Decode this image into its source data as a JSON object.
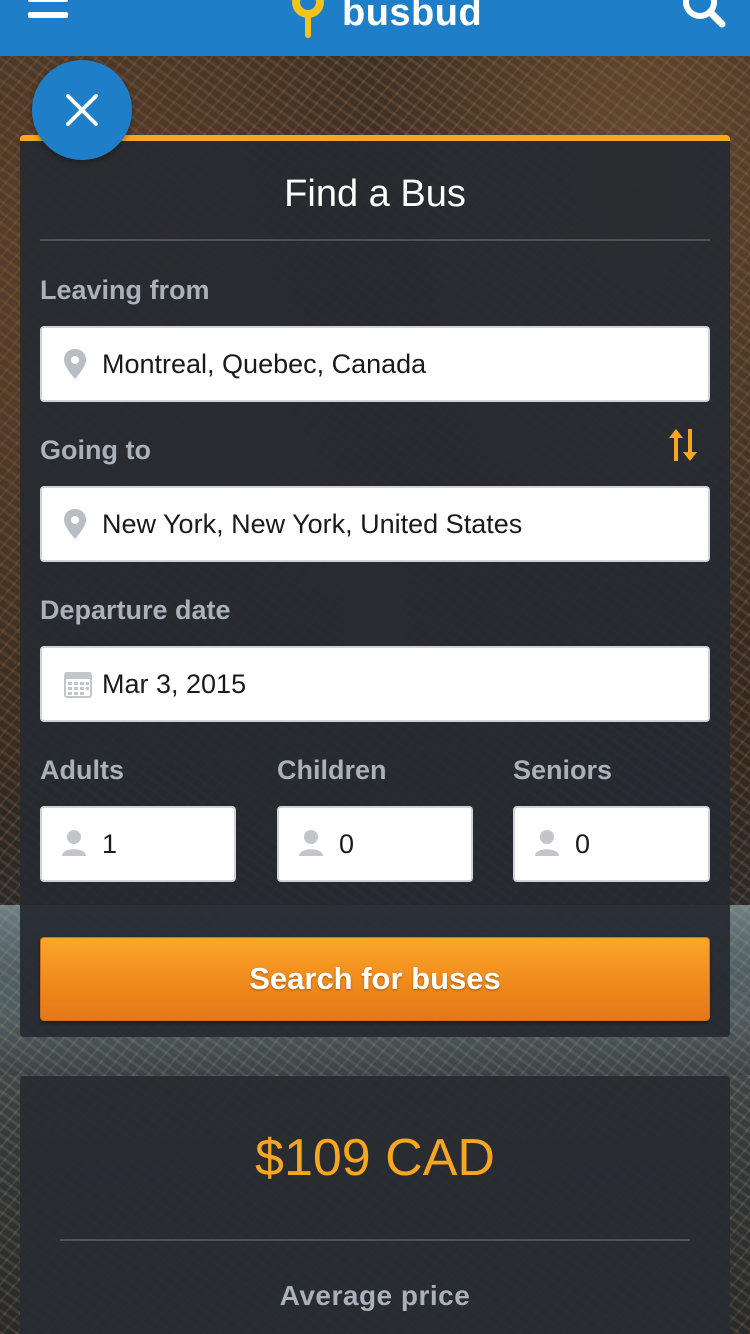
{
  "header": {
    "brand": "busbud",
    "brand_color": "#1e7fc8",
    "menu_icon": "hamburger-menu-icon",
    "search_icon": "search-icon"
  },
  "close_icon": "close-icon",
  "form": {
    "title": "Find a Bus",
    "accent_color": "#f7a623",
    "leaving_from": {
      "label": "Leaving from",
      "value": "Montreal, Quebec, Canada",
      "icon": "location-pin-icon"
    },
    "going_to": {
      "label": "Going to",
      "value": "New York, New York, United States",
      "icon": "location-pin-icon",
      "swap_icon": "swap-arrows-icon"
    },
    "departure_date": {
      "label": "Departure date",
      "value": "Mar 3, 2015",
      "icon": "calendar-icon"
    },
    "passengers": [
      {
        "label": "Adults",
        "value": "1",
        "icon": "person-icon"
      },
      {
        "label": "Children",
        "value": "0",
        "icon": "person-icon"
      },
      {
        "label": "Seniors",
        "value": "0",
        "icon": "person-icon"
      }
    ],
    "search_button": "Search for buses"
  },
  "price_card": {
    "price": "$109 CAD",
    "label": "Average price"
  }
}
